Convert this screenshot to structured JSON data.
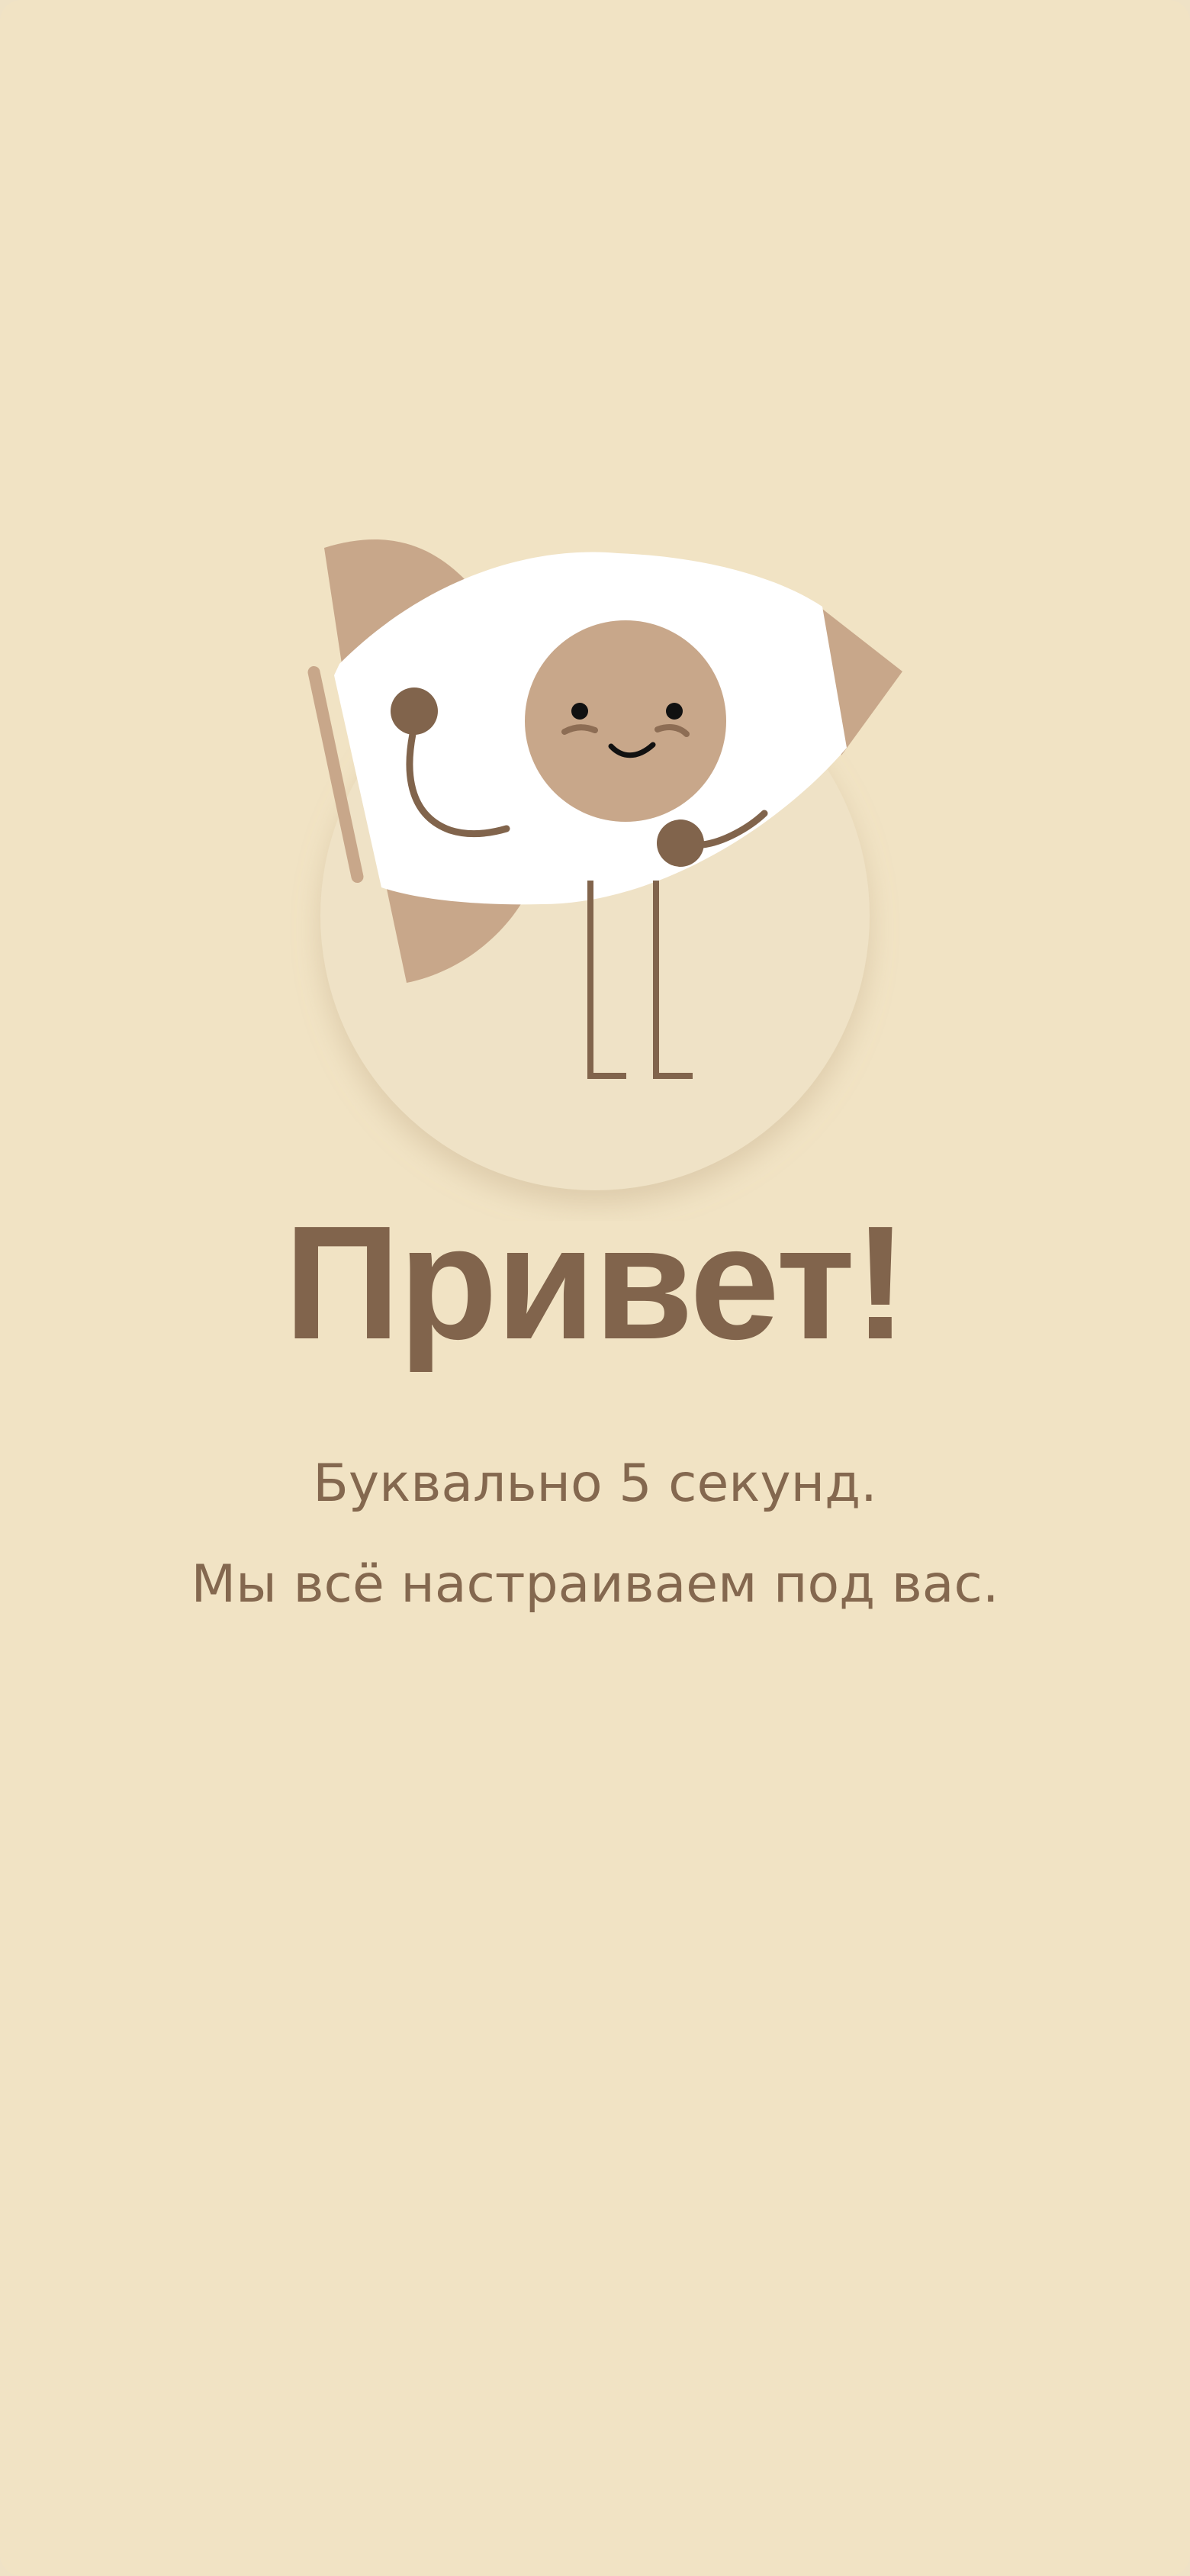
{
  "screen": {
    "title": "Привет!",
    "subtitle_line_1": "Буквально 5 секунд.",
    "subtitle_line_2": "Мы всё настраиваем под вас."
  },
  "colors": {
    "background": "#f1e3c4",
    "accent_brown": "#81644c",
    "wing_tan": "#c8a78a",
    "shadow_circle": "#efe2c6",
    "mascot_white": "#ffffff"
  },
  "illustration": {
    "name": "mascot-hello"
  }
}
